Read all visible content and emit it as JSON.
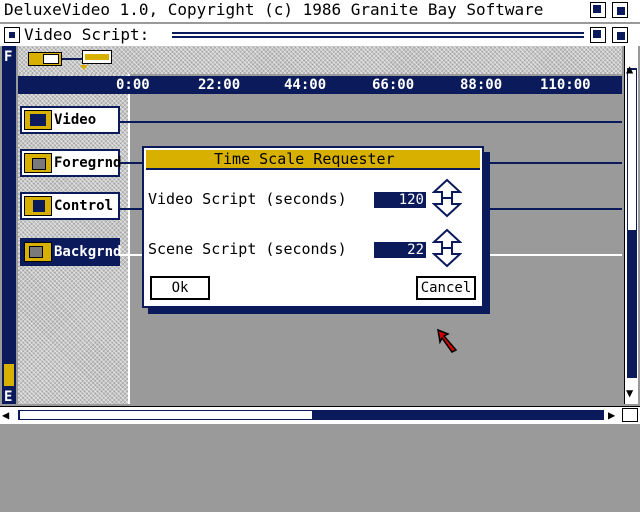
{
  "screen": {
    "title": "DeluxeVideo 1.0, Copyright (c) 1986 Granite Bay Software"
  },
  "window": {
    "title": "Video Script:",
    "side_top_letter": "F",
    "side_bottom_letter": "E"
  },
  "timeline": {
    "ticks": [
      "0:00",
      "22:00",
      "44:00",
      "66:00",
      "88:00",
      "110:00"
    ]
  },
  "tracks": [
    {
      "label": "Video"
    },
    {
      "label": "Foregrnd"
    },
    {
      "label": "Control"
    },
    {
      "label": "Backgrnd"
    }
  ],
  "dialog": {
    "title": "Time Scale Requester",
    "video_label": "Video Script (seconds)",
    "video_value": "120",
    "scene_label": "Scene Script (seconds)",
    "scene_value": "22",
    "ok_label": "Ok",
    "cancel_label": "Cancel"
  },
  "colors": {
    "navy": "#0a1a5a",
    "gold": "#d7b000",
    "white": "#ffffff",
    "desktop": "#9a9a9a"
  }
}
